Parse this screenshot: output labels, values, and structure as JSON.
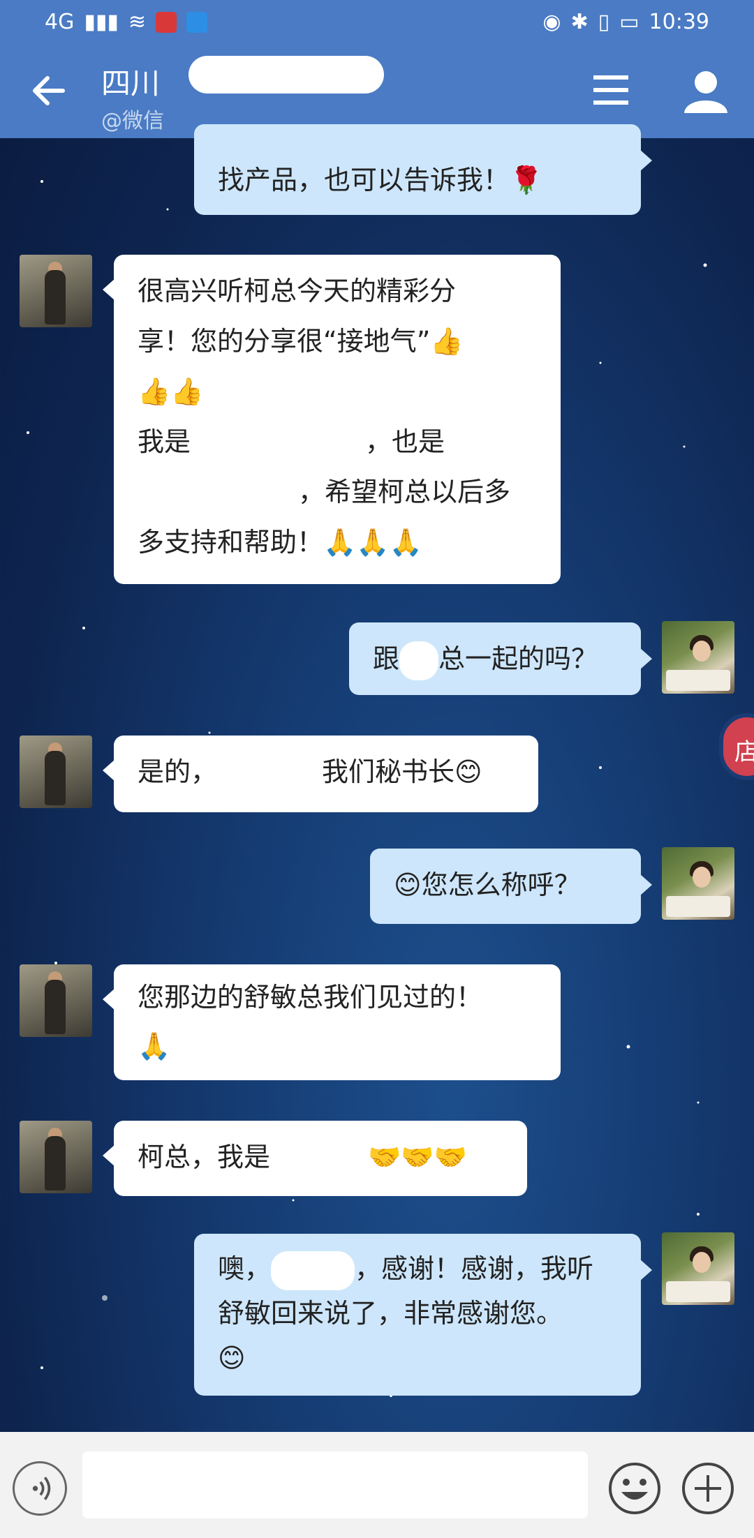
{
  "status_bar": {
    "network": "4G",
    "time": "10:39"
  },
  "header": {
    "title": "四川",
    "subtitle": "@微信",
    "back_icon": "arrow-left-icon",
    "menu_icon": "menu-icon",
    "profile_icon": "person-icon"
  },
  "messages": [
    {
      "side": "out",
      "lines": [
        "找产品，也可以告诉我！🌹"
      ]
    },
    {
      "side": "in",
      "lines": [
        "很高兴听柯总今天的精彩分",
        "享！您的分享很“接地气”👍",
        "👍👍",
        "我是",
        "，也是",
        "，希望柯总以后多",
        "多支持和帮助！🙏🙏🙏"
      ]
    },
    {
      "side": "out",
      "text_a": "跟",
      "text_b": "总一起的吗？"
    },
    {
      "side": "in",
      "text_a": "是的，",
      "text_b": "我们秘书长",
      "emoji": "😊"
    },
    {
      "side": "out",
      "emoji": "😊",
      "text": "您怎么称呼？"
    },
    {
      "side": "in",
      "lines": [
        "您那边的舒敏总我们见过的！",
        "🙏"
      ]
    },
    {
      "side": "in",
      "text": "柯总，我是",
      "emoji": "🤝🤝🤝"
    },
    {
      "side": "out",
      "lines": [
        "噢，",
        "，感谢！感谢，我听",
        "舒敏回来说了，非常感谢您。",
        "😊"
      ]
    }
  ],
  "side_button": {
    "label": "店"
  },
  "input_bar": {
    "voice_icon": "voice-icon",
    "emoji_icon": "smiley-icon",
    "plus_icon": "plus-icon"
  },
  "colors": {
    "header": "#4a7bc4",
    "incoming_bubble": "#ffffff",
    "outgoing_bubble": "#cde6fb"
  }
}
